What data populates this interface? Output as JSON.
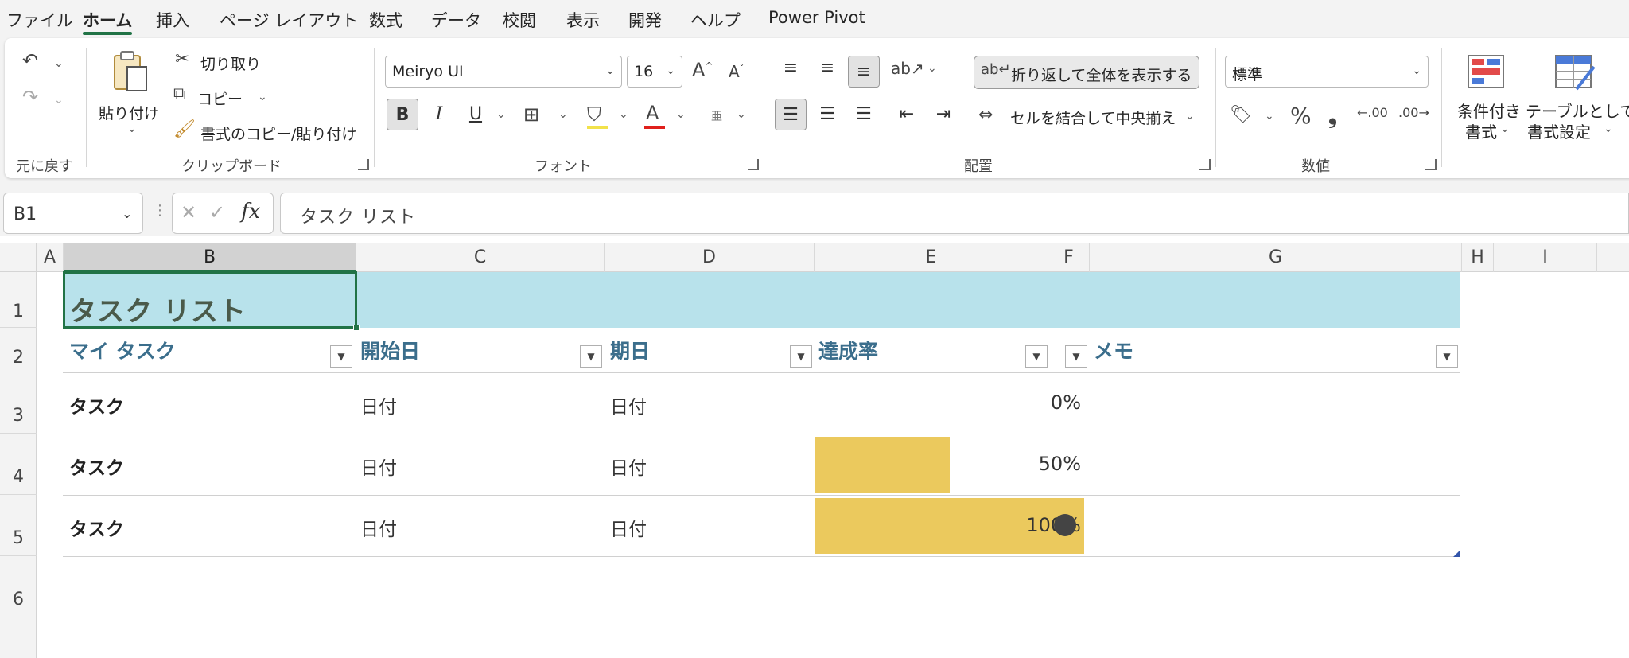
{
  "menu": {
    "items": [
      "ファイル",
      "ホーム",
      "挿入",
      "ページ レイアウト",
      "数式",
      "データ",
      "校閲",
      "表示",
      "開発",
      "ヘルプ",
      "Power Pivot"
    ],
    "active": "ホーム"
  },
  "ribbon": {
    "undo_group_label": "元に戻す",
    "clipboard": {
      "paste_label": "貼り付け",
      "cut_label": "切り取り",
      "copy_label": "コピー",
      "format_painter_label": "書式のコピー/貼り付け",
      "group_label": "クリップボード"
    },
    "font": {
      "font_name": "Meiryo UI",
      "font_size": "16",
      "group_label": "フォント",
      "bold": "B",
      "italic": "I",
      "underline": "U",
      "phonetic": "亜"
    },
    "alignment": {
      "wrap_text_label": "折り返して全体を表示する",
      "merge_center_label": "セルを結合して中央揃え",
      "group_label": "配置"
    },
    "number": {
      "format": "標準",
      "percent": "%",
      "comma": "❟",
      "group_label": "数値"
    },
    "styles": {
      "conditional_label_1": "条件付き",
      "conditional_label_2": "書式",
      "table_label_1": "テーブルとして",
      "table_label_2": "書式設定"
    }
  },
  "formula_bar": {
    "name_box": "B1",
    "formula": "タスク リスト"
  },
  "grid": {
    "columns": [
      "A",
      "B",
      "C",
      "D",
      "E",
      "F",
      "G",
      "H",
      "I"
    ],
    "selected_column": "B",
    "rows": [
      "1",
      "2",
      "3",
      "4",
      "5",
      "6"
    ]
  },
  "table": {
    "title": "タスク リスト",
    "headers": [
      "マイ タスク",
      "開始日",
      "期日",
      "達成率",
      "メモ"
    ],
    "rows": [
      {
        "task": "タスク",
        "start": "日付",
        "due": "日付",
        "progress_label": "0%",
        "progress": 0.0
      },
      {
        "task": "タスク",
        "start": "日付",
        "due": "日付",
        "progress_label": "50%",
        "progress": 0.5
      },
      {
        "task": "タスク",
        "start": "日付",
        "due": "日付",
        "progress_label": "100%",
        "progress": 1.0
      }
    ],
    "colors": {
      "title_band": "#b8e2eb",
      "header_text": "#3b6e8c",
      "databar": "#ebc95d",
      "selection": "#217346"
    }
  }
}
